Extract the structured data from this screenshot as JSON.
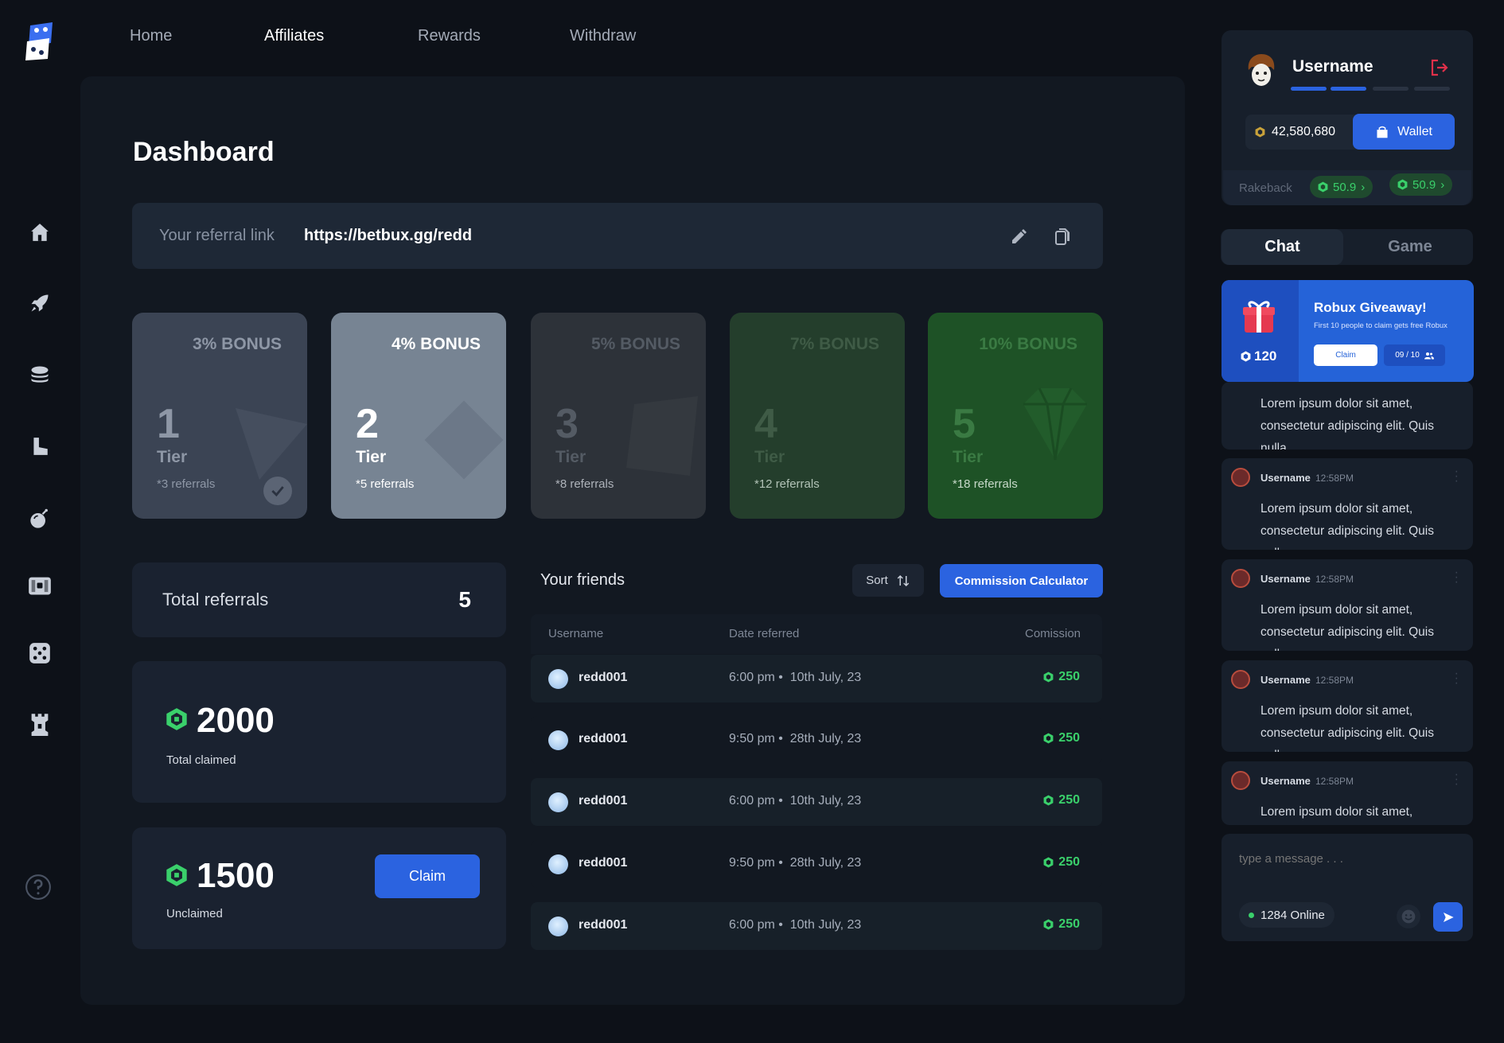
{
  "nav": {
    "home": "Home",
    "affiliates": "Affiliates",
    "rewards": "Rewards",
    "withdraw": "Withdraw"
  },
  "sidebar": {
    "icons": [
      "home-icon",
      "rocket-icon",
      "coin-stack-icon",
      "boot-icon",
      "bomb-icon",
      "chest-icon",
      "dice-icon",
      "tower-icon",
      "help-icon"
    ]
  },
  "page": {
    "title": "Dashboard"
  },
  "referral": {
    "label": "Your referral link",
    "link": "https://betbux.gg/redd"
  },
  "tiers": [
    {
      "bonus": "3% BONUS",
      "num": "1",
      "label": "Tier",
      "refs": "*3 referrals",
      "completed": true
    },
    {
      "bonus": "4% BONUS",
      "num": "2",
      "label": "Tier",
      "refs": "*5 referrals"
    },
    {
      "bonus": "5% BONUS",
      "num": "3",
      "label": "Tier",
      "refs": "*8 referrals"
    },
    {
      "bonus": "7% BONUS",
      "num": "4",
      "label": "Tier",
      "refs": "*12 referrals"
    },
    {
      "bonus": "10% BONUS",
      "num": "5",
      "label": "Tier",
      "refs": "*18 referrals"
    }
  ],
  "stats": {
    "total_referrals_label": "Total referrals",
    "total_referrals": "5",
    "claimed_value": "2000",
    "claimed_label": "Total claimed",
    "unclaimed_value": "1500",
    "unclaimed_label": "Unclaimed",
    "claim_button": "Claim"
  },
  "friends": {
    "title": "Your friends",
    "sort_label": "Sort",
    "calc_button": "Commission Calculator",
    "headers": {
      "username": "Username",
      "date": "Date referred",
      "commission": "Comission"
    },
    "rows": [
      {
        "username": "redd001",
        "time": "6:00 pm",
        "date": "10th July, 23",
        "commission": "250"
      },
      {
        "username": "redd001",
        "time": "9:50 pm",
        "date": "28th July, 23",
        "commission": "250"
      },
      {
        "username": "redd001",
        "time": "6:00 pm",
        "date": "10th July, 23",
        "commission": "250"
      },
      {
        "username": "redd001",
        "time": "9:50 pm",
        "date": "28th July, 23",
        "commission": "250"
      },
      {
        "username": "redd001",
        "time": "6:00 pm",
        "date": "10th July, 23",
        "commission": "250"
      }
    ]
  },
  "user": {
    "username": "Username",
    "balance": "42,580,680",
    "wallet_button": "Wallet",
    "level_progress": 0.5,
    "rakeback_label": "Rakeback",
    "rakeback_1": "50.9",
    "rakeback_2": "50.9"
  },
  "chat_tabs": {
    "chat": "Chat",
    "game": "Game"
  },
  "giveaway": {
    "amount": "120",
    "title": "Robux Giveaway!",
    "subtitle": "First 10 people to claim gets free Robux",
    "claim": "Claim",
    "count": "09 / 10"
  },
  "messages": [
    {
      "username": "",
      "time": "",
      "text": "Lorem ipsum dolor sit amet, consectetur adipiscing elit. Quis nulla"
    },
    {
      "username": "Username",
      "time": "12:58PM",
      "text": "Lorem ipsum dolor sit amet, consectetur adipiscing elit. Quis nulla"
    },
    {
      "username": "Username",
      "time": "12:58PM",
      "text": "Lorem ipsum dolor sit amet, consectetur adipiscing elit. Quis nulla"
    },
    {
      "username": "Username",
      "time": "12:58PM",
      "text": "Lorem ipsum dolor sit amet, consectetur adipiscing elit. Quis nulla"
    },
    {
      "username": "Username",
      "time": "12:58PM",
      "text": "Lorem ipsum dolor sit amet,"
    }
  ],
  "chat_input": {
    "placeholder": "type a message . . .",
    "online": "1284 Online"
  },
  "colors": {
    "accent": "#2b63e0",
    "green": "#3ad06b",
    "bg": "#0d1118",
    "panel": "#121821"
  }
}
